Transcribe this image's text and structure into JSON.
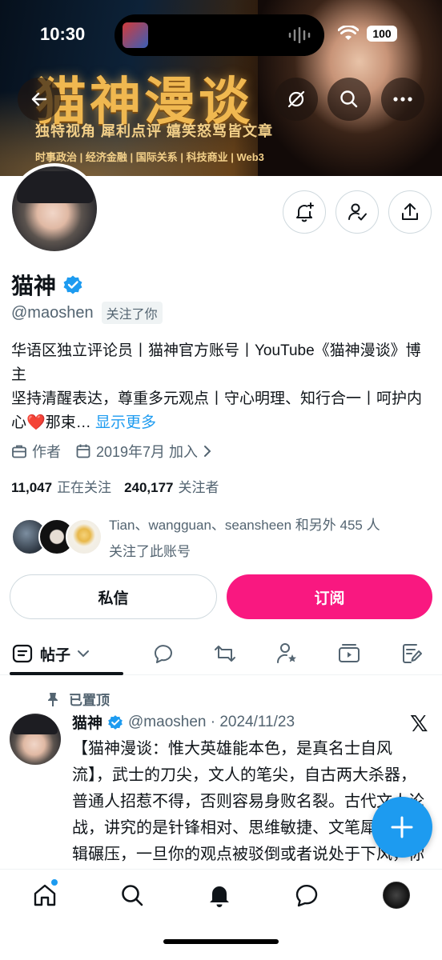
{
  "status_bar": {
    "time": "10:30",
    "battery": "100"
  },
  "banner": {
    "title": "猫神漫谈",
    "subtitle": "独特视角  犀利点评  嬉笑怒骂皆文章",
    "tags": "时事政治 | 经济金融 | 国际关系 | 科技商业 | Web3"
  },
  "profile": {
    "display_name": "猫神",
    "handle": "@maoshen",
    "follows_you": "关注了你",
    "bio_line1": "华语区独立评论员丨猫神官方账号丨YouTube《猫神漫谈》博主",
    "bio_line2": "坚持清醒表达，尊重多元观点丨守心明理、知行合一丨呵护内心",
    "bio_heart": "❤️",
    "bio_tail": "那束…",
    "show_more": "显示更多",
    "occupation": "作者",
    "joined": "2019年7月 加入",
    "following_count": "11,047",
    "following_label": "正在关注",
    "followers_count": "240,177",
    "followers_label": "关注者",
    "known_followers_line1": "Tian、wangguan、seansheen 和另外 455 人",
    "known_followers_line2": "关注了此账号"
  },
  "actions": {
    "dm": "私信",
    "subscribe": "订阅"
  },
  "tabs": {
    "posts": "帖子"
  },
  "pinned_label": "已置顶",
  "tweet": {
    "name": "猫神",
    "meta": "@maoshen · 2024/11/23",
    "text": "【猫神漫谈：惟大英雄能本色，是真名士自风流】，武士的刀尖，文人的笔尖，自古两大杀器，普通人招惹不得，否则容易身败名裂。古代文人论战，讲究的是针锋相对、思维敏捷、文笔犀利和逻辑碾压，一旦你的观点被驳倒或者说处于下风，你就应该公开认输，保持文"
  },
  "colors": {
    "accent": "#1d9bf0",
    "subscribe": "#f91880",
    "verified": "#1d9bf0"
  },
  "icons": [
    "back-icon",
    "grok-icon",
    "search-icon",
    "more-icon",
    "bell-plus-icon",
    "user-check-icon",
    "share-icon",
    "verified-icon",
    "briefcase-icon",
    "calendar-icon",
    "pin-icon",
    "x-logo-icon",
    "plus-icon",
    "home-icon",
    "search-nav-icon",
    "bell-nav-icon",
    "messages-icon"
  ]
}
